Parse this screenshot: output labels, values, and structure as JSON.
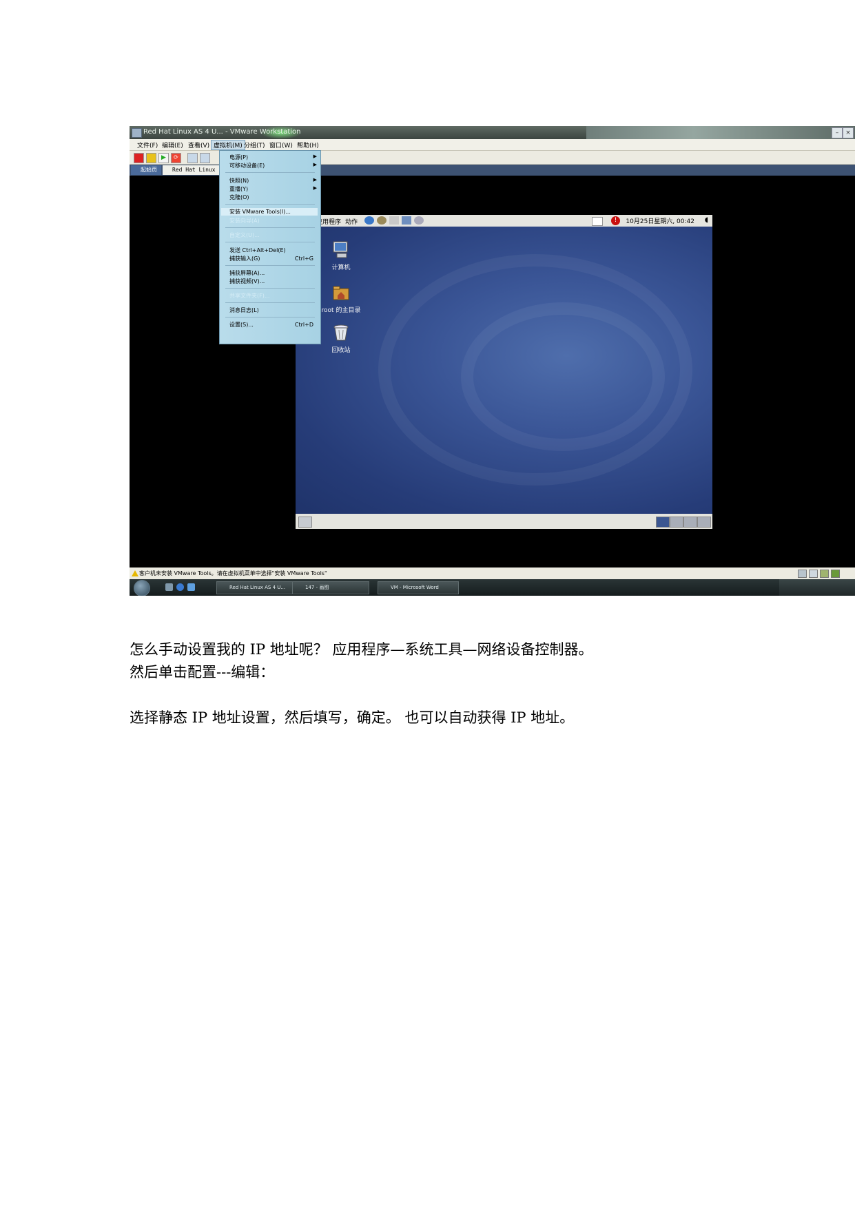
{
  "window": {
    "title": "Red Hat Linux AS 4 U... - VMware Workstation"
  },
  "menubar": [
    "文件(F)",
    "编辑(E)",
    "查看(V)",
    "虚拟机(M)",
    "分组(T)",
    "窗口(W)",
    "帮助(H)"
  ],
  "tabs": {
    "home": "起始页",
    "vm": "Red Hat Linux"
  },
  "vm_menu": {
    "items": [
      {
        "label": "电源(P)",
        "submenu": true
      },
      {
        "label": "可移动设备(E)",
        "submenu": true
      },
      {
        "label": "快照(N)",
        "submenu": true
      },
      {
        "label": "重播(Y)",
        "submenu": true
      },
      {
        "label": "克隆(O)"
      },
      {
        "label": "安装 VMware Tools(I)..."
      },
      {
        "label": "安装向导(A)",
        "disabled": true
      },
      {
        "label": "自定义(U)...",
        "disabled": true
      },
      {
        "label": "发送 Ctrl+Alt+Del(E)"
      },
      {
        "label": "捕获输入(G)",
        "shortcut": "Ctrl+G"
      },
      {
        "label": "捕获屏幕(A)..."
      },
      {
        "label": "捕获视频(V)..."
      },
      {
        "label": "共享文件夹(F)...",
        "disabled": true
      },
      {
        "label": "消息日志(L)"
      },
      {
        "label": "设置(S)...",
        "shortcut": "Ctrl+D"
      }
    ]
  },
  "gnome": {
    "menu_apps": "应用程序",
    "menu_actions": "动作",
    "clock": "10月25日星期六, 00:42"
  },
  "desktop_icons": {
    "computer": "计算机",
    "home": "root 的主目录",
    "trash": "回收站"
  },
  "statusbar": {
    "message": "客户机未安装 VMware Tools。请在虚拟机菜单中选择\"安装 VMware Tools\""
  },
  "taskbar": {
    "items": [
      "Red Hat Linux AS 4 U...",
      "147 - 画图",
      "VM - Microsoft Word"
    ]
  },
  "document": {
    "line1": "怎么手动设置我的 IP 地址呢？  应用程序—系统工具—网络设备控制器。",
    "line2": "然后单击配置---编辑：",
    "line3": "选择静态 IP 地址设置，然后填写，确定。  也可以自动获得 IP 地址。"
  }
}
